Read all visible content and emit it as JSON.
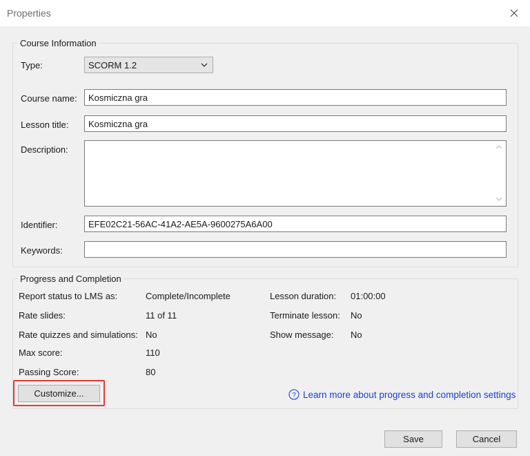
{
  "window": {
    "title": "Properties"
  },
  "course_info": {
    "legend": "Course Information",
    "type_label": "Type:",
    "type_value": "SCORM 1.2",
    "course_name_label": "Course name:",
    "course_name_value": "Kosmiczna gra",
    "lesson_title_label": "Lesson title:",
    "lesson_title_value": "Kosmiczna gra",
    "description_label": "Description:",
    "description_value": "",
    "identifier_label": "Identifier:",
    "identifier_value": "EFE02C21-56AC-41A2-AE5A-9600275A6A00",
    "keywords_label": "Keywords:",
    "keywords_value": ""
  },
  "progress": {
    "legend": "Progress and Completion",
    "report_status_label": "Report status to LMS as:",
    "report_status_value": "Complete/Incomplete",
    "rate_slides_label": "Rate slides:",
    "rate_slides_value": "11 of 11",
    "rate_quizzes_label": "Rate quizzes and simulations:",
    "rate_quizzes_value": "No",
    "max_score_label": "Max score:",
    "max_score_value": "110",
    "passing_score_label": "Passing Score:",
    "passing_score_value": "80",
    "lesson_duration_label": "Lesson duration:",
    "lesson_duration_value": "01:00:00",
    "terminate_lesson_label": "Terminate lesson:",
    "terminate_lesson_value": "No",
    "show_message_label": "Show message:",
    "show_message_value": "No",
    "customize_label": "Customize...",
    "help_link_text": "Learn more about progress and completion settings"
  },
  "footer": {
    "save_label": "Save",
    "cancel_label": "Cancel"
  },
  "colors": {
    "link": "#1a3fd6",
    "highlight": "#e53935",
    "dialog_bg": "#f0f0f0"
  },
  "icons": {
    "close": "close-icon",
    "dropdown": "chevron-down-icon",
    "help": "help-circle-icon"
  }
}
